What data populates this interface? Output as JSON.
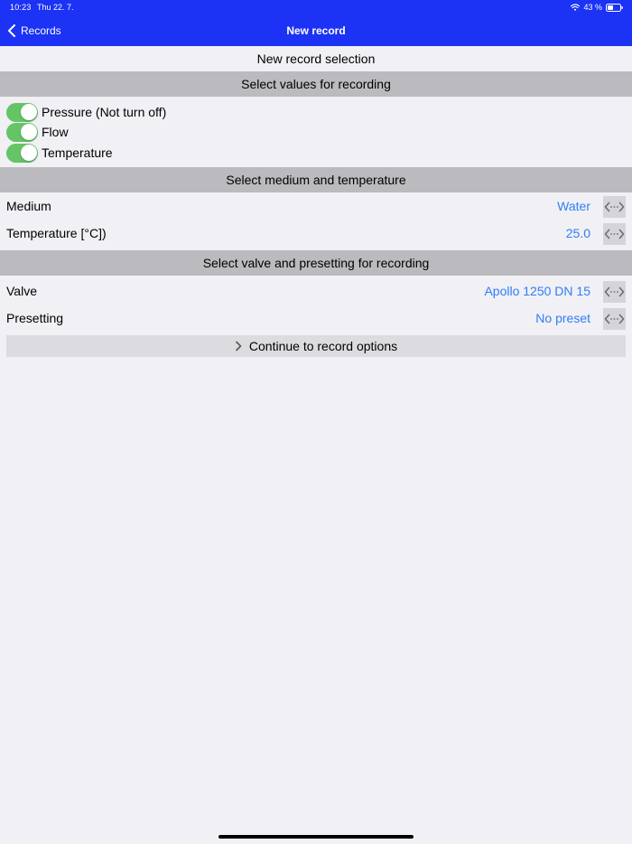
{
  "status_bar": {
    "time": "10:23",
    "date": "Thu 22. 7.",
    "battery": "43 %"
  },
  "nav": {
    "back_label": "Records",
    "title": "New record"
  },
  "page": {
    "subtitle": "New record selection"
  },
  "sections": {
    "values": {
      "header": "Select values for recording",
      "toggles": [
        {
          "label": "Pressure (Not turn off)",
          "on": true
        },
        {
          "label": "Flow",
          "on": true
        },
        {
          "label": "Temperature",
          "on": true
        }
      ]
    },
    "medium": {
      "header": "Select medium and temperature",
      "rows": [
        {
          "label": "Medium",
          "value": "Water"
        },
        {
          "label": "Temperature [°C])",
          "value": "25.0"
        }
      ]
    },
    "valve": {
      "header": "Select valve and presetting for recording",
      "rows": [
        {
          "label": "Valve",
          "value": "Apollo 1250 DN 15"
        },
        {
          "label": "Presetting",
          "value": "No preset"
        }
      ]
    }
  },
  "continue": {
    "label": "Continue to record options"
  },
  "colors": {
    "nav_background": "#1c32f5",
    "section_header": "#bbbbbf",
    "page_background": "#f0f0f5",
    "value_text": "#2f7ef6",
    "switch_on": "#65c466"
  },
  "icons": {
    "back": "chevron-left-icon",
    "swap": "swap-horizontal-icon",
    "continue": "chevron-right-icon"
  }
}
